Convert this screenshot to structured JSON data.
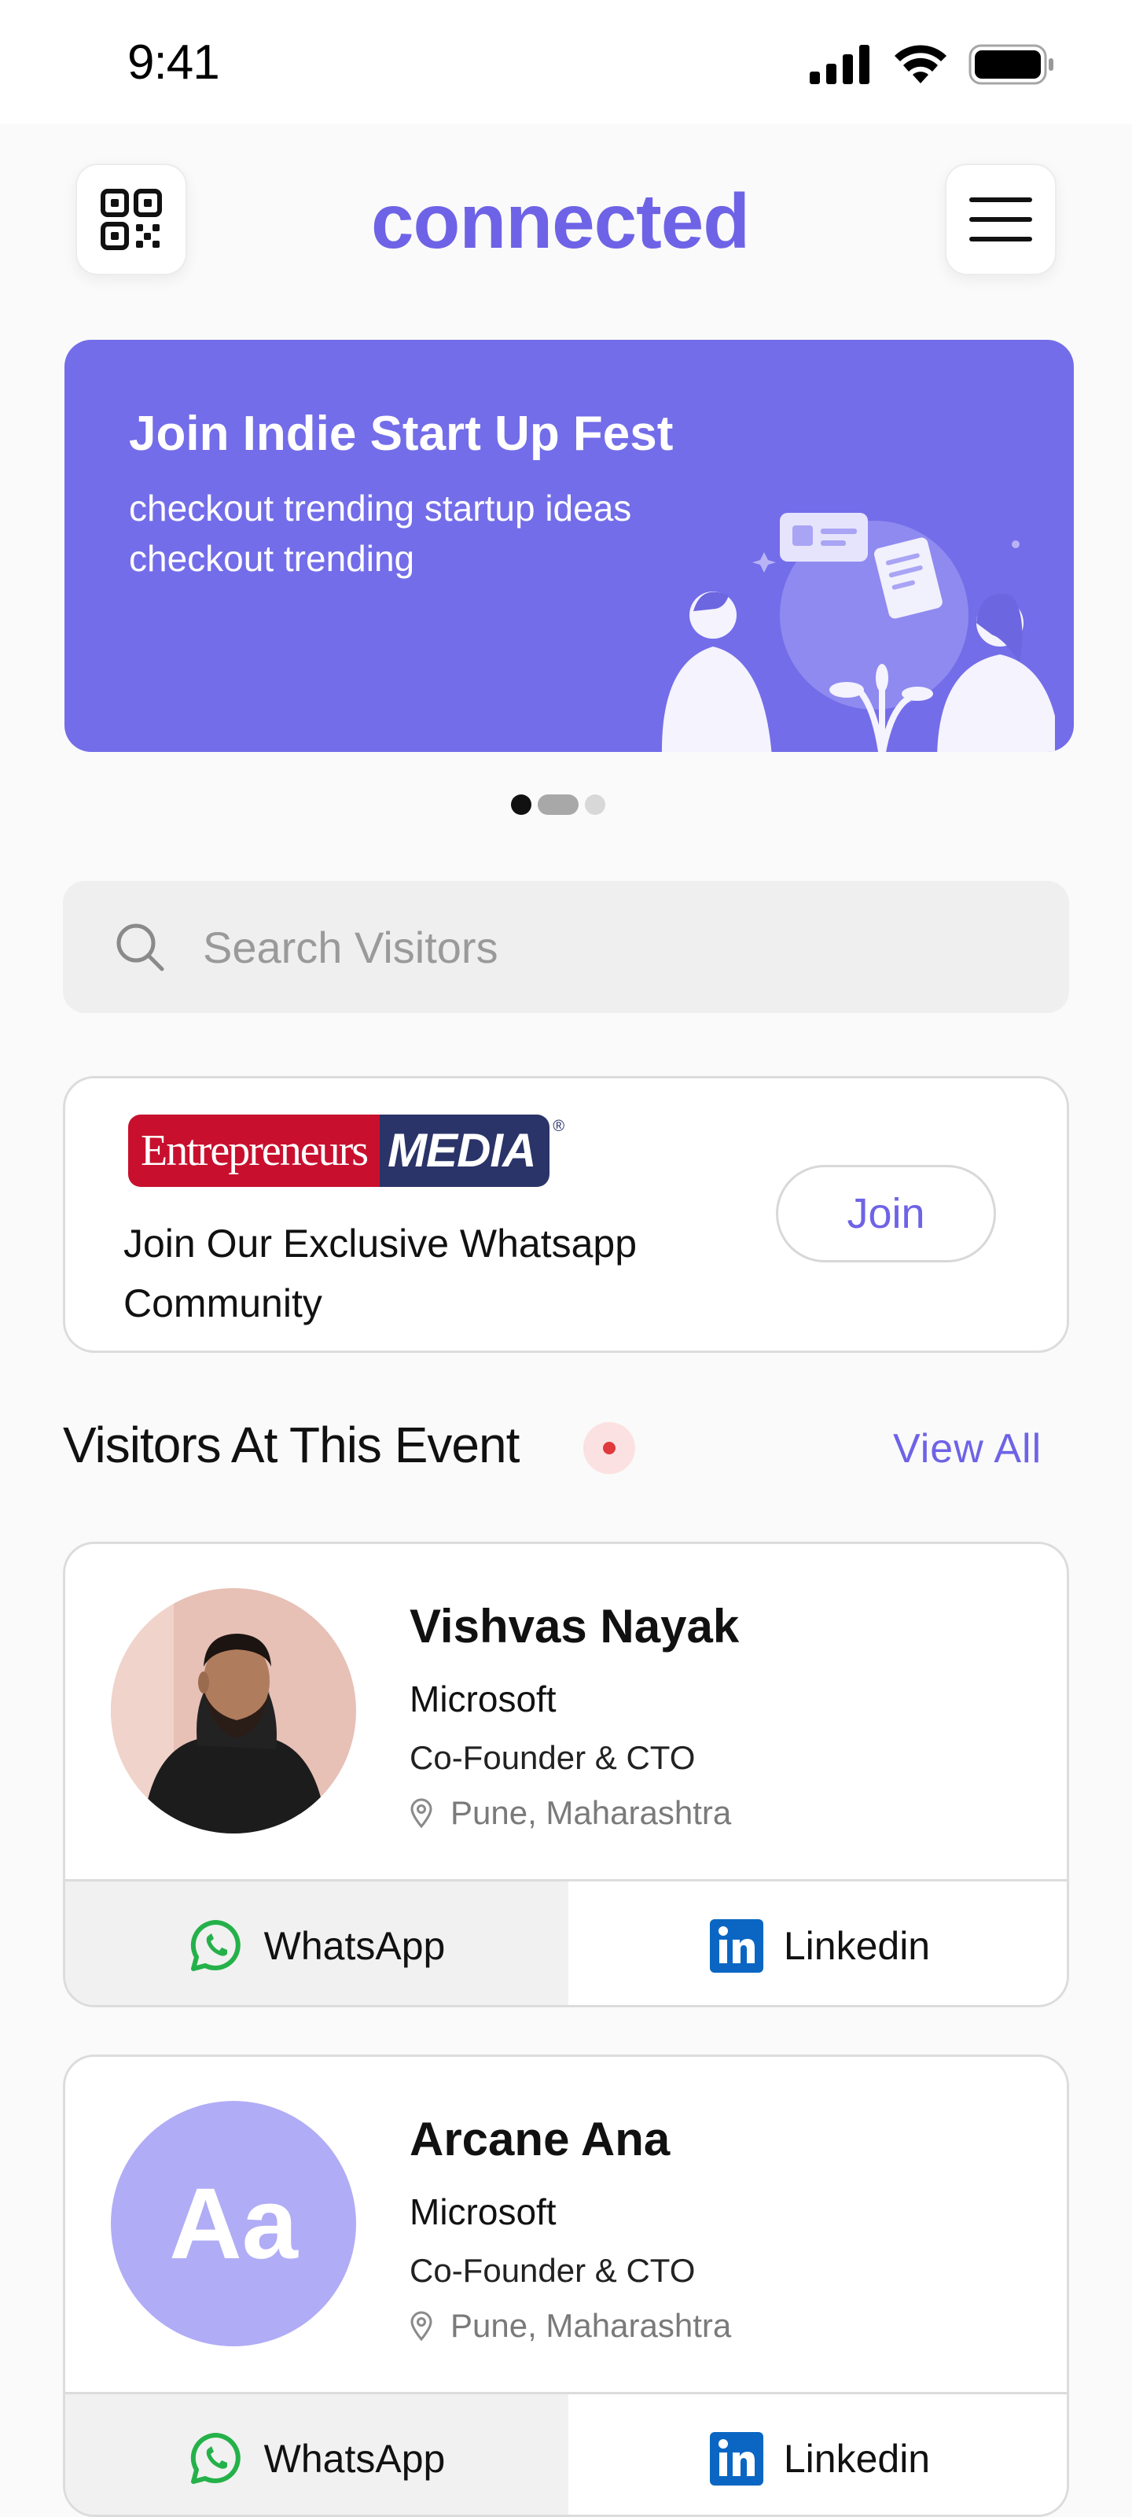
{
  "status_bar": {
    "time": "9:41"
  },
  "header": {
    "logo_text": "connected"
  },
  "banner": {
    "title": "Join Indie Start Up Fest",
    "subtitle": "checkout trending startup ideas checkout trending",
    "carousel": {
      "count": 3,
      "active": 0
    }
  },
  "search": {
    "placeholder": "Search Visitors"
  },
  "community": {
    "brand_left": "Entrepreneurs",
    "brand_right": "MEDIA",
    "brand_mark": "®",
    "text": "Join Our Exclusive Whatsapp Community",
    "join_label": "Join"
  },
  "visitors_section": {
    "title": "Visitors At This Event",
    "view_all_label": "View All"
  },
  "visitors": [
    {
      "name": "Vishvas Nayak",
      "company": "Microsoft",
      "role": "Co-Founder & CTO",
      "location": "Pune, Maharashtra",
      "avatar_type": "photo",
      "whatsapp_label": "WhatsApp",
      "linkedin_label": "Linkedin"
    },
    {
      "name": "Arcane Ana",
      "company": "Microsoft",
      "role": "Co-Founder & CTO",
      "location": "Pune, Maharashtra",
      "avatar_type": "initials",
      "initials": "Aa",
      "whatsapp_label": "WhatsApp",
      "linkedin_label": "Linkedin"
    }
  ],
  "colors": {
    "brand": "#6e63e6",
    "banner": "#736de9",
    "whatsapp": "#25b14a",
    "linkedin": "#0a66c2",
    "live": "#e0393e"
  },
  "icons": [
    "qr-code-icon",
    "menu-icon",
    "search-icon",
    "location-pin-icon",
    "whatsapp-icon",
    "linkedin-icon",
    "signal-icon",
    "wifi-icon",
    "battery-icon"
  ]
}
